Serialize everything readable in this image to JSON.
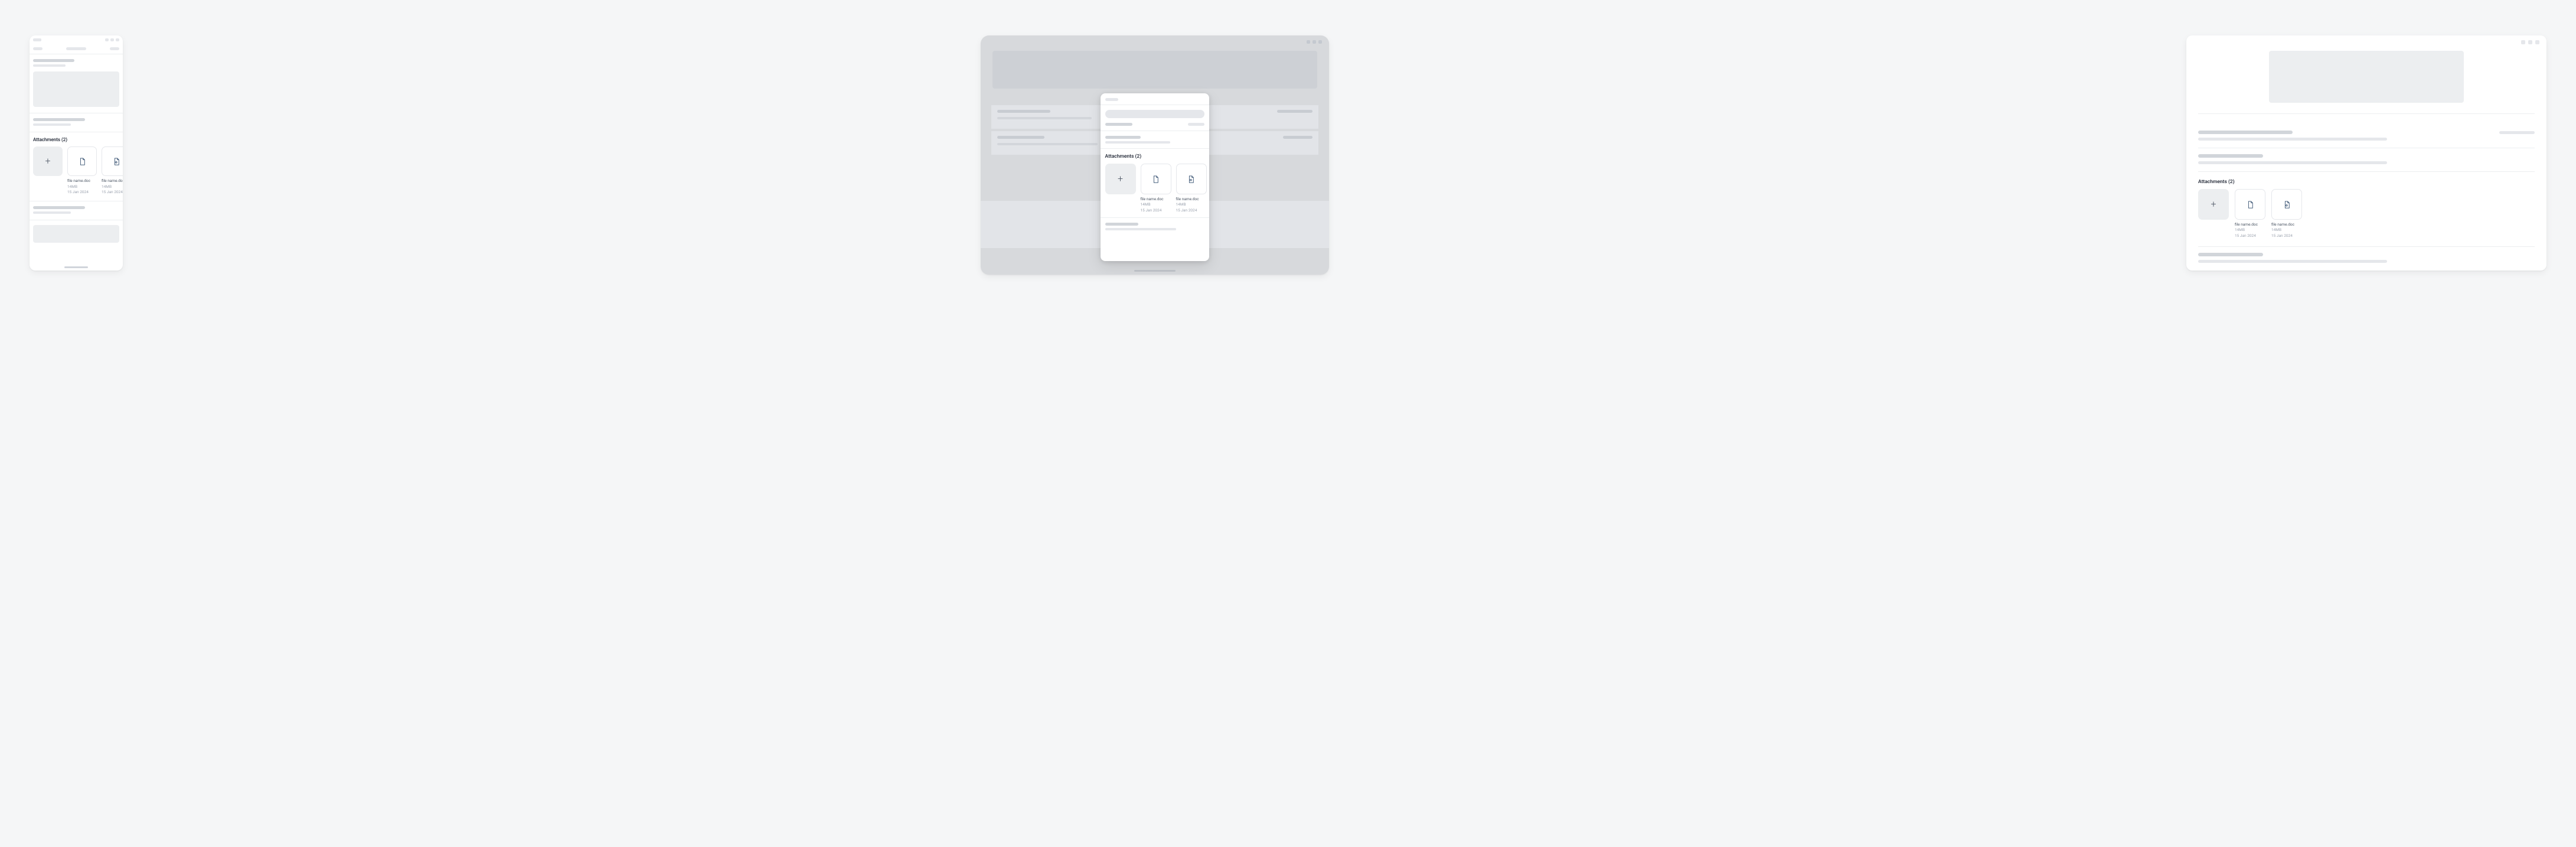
{
  "attachments": {
    "label": "Attachments (2)",
    "add_button_label": "+",
    "files": [
      {
        "name": "file name.doc",
        "size": "14MB",
        "date": "15 Jan 2024",
        "icon": "document"
      },
      {
        "name": "file name.doc",
        "size": "14MB",
        "date": "15 Jan 2024",
        "icon": "document-alt"
      }
    ]
  },
  "colors": {
    "icon_stroke": "#2f4a6b",
    "page_bg": "#f5f6f7",
    "card_bg": "#ffffff",
    "tile_add_bg": "#eceef0",
    "border": "#e5e7eb"
  }
}
